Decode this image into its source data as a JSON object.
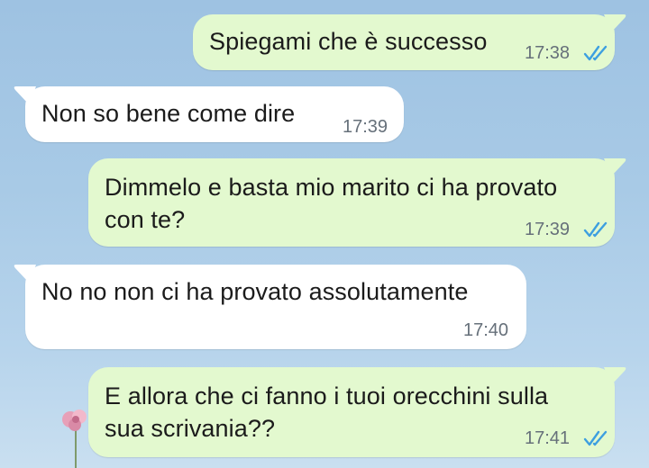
{
  "conversation": {
    "messages": [
      {
        "direction": "outgoing",
        "lines": [
          "Spiegami che è successo"
        ],
        "time": "17:38",
        "read": true
      },
      {
        "direction": "incoming",
        "lines": [
          "Non so bene come dire"
        ],
        "time": "17:39"
      },
      {
        "direction": "outgoing",
        "lines": [
          "Dimmelo e basta mio marito ci ha provato",
          "con te?"
        ],
        "time": "17:39",
        "read": true
      },
      {
        "direction": "incoming",
        "lines": [
          "No no non ci ha provato assolutamente"
        ],
        "time": "17:40"
      },
      {
        "direction": "outgoing",
        "lines": [
          "E allora che ci fanno i tuoi orecchini sulla",
          "sua scrivania??"
        ],
        "time": "17:41",
        "read": true
      }
    ]
  },
  "colors": {
    "outgoing_bubble": "#e3f9cf",
    "incoming_bubble": "#ffffff",
    "read_ticks": "#3d9fe0",
    "timestamp": "#66707a",
    "wallpaper": "#a8cae6"
  },
  "icons": {
    "read_receipt": "double-check-icon"
  }
}
